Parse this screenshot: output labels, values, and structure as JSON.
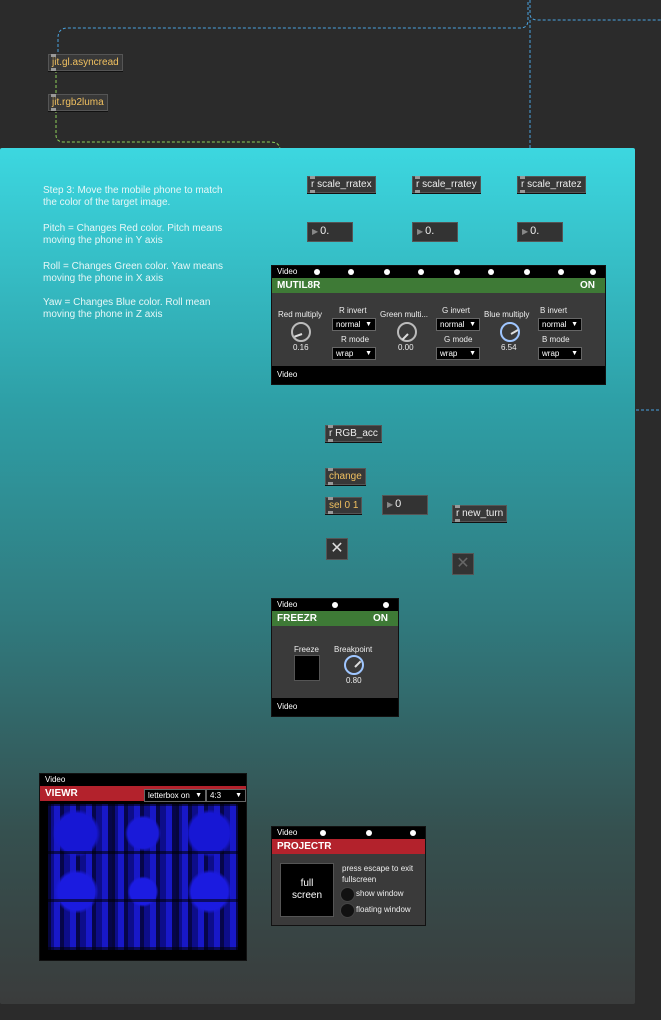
{
  "objects": {
    "asyncread": "jit.gl.asyncread",
    "rgb2luma": "jit.rgb2luma",
    "scale_x": "r scale_rratex",
    "scale_y": "r scale_rratey",
    "scale_z": "r scale_rratez",
    "num_x": "0.",
    "num_y": "0.",
    "num_z": "0.",
    "rgb_acc": "r RGB_acc",
    "change": "change",
    "sel": "sel 0 1",
    "num_sel": "0",
    "new_turn": "r new_turn"
  },
  "instructions": {
    "step": "Step 3: Move the mobile phone to match the color of the target image.",
    "pitch": "Pitch = Changes Red color. Pitch means moving the phone in Y axis",
    "roll": "Roll = Changes Green color. Yaw means moving the phone in X axis",
    "yaw": "Yaw =  Changes Blue color. Roll mean moving the phone in Z axis"
  },
  "mutil8r": {
    "top_label": "Video",
    "title": "MUTIL8R",
    "status": "ON",
    "red_label": "Red multiply",
    "red_value": "0.16",
    "green_label": "Green multi...",
    "green_value": "0.00",
    "blue_label": "Blue multiply",
    "blue_value": "6.54",
    "r_invert_label": "R invert",
    "r_invert": "normal",
    "r_mode_label": "R mode",
    "r_mode": "wrap",
    "g_invert_label": "G invert",
    "g_invert": "normal",
    "g_mode_label": "G mode",
    "g_mode": "wrap",
    "b_invert_label": "B invert",
    "b_invert": "normal",
    "b_mode_label": "B mode",
    "b_mode": "wrap",
    "foot_label": "Video"
  },
  "freezr": {
    "top_label": "Video",
    "title": "FREEZR",
    "status": "ON",
    "freeze_label": "Freeze",
    "breakpoint_label": "Breakpoint",
    "breakpoint_value": "0.80",
    "foot_label": "Video"
  },
  "viewr": {
    "top_label": "Video",
    "title": "VIEWR",
    "letterbox": "letterbox on",
    "aspect": "4:3"
  },
  "projectr": {
    "top_label": "Video",
    "title": "PROJECTR",
    "fullscreen_label": "full\nscreen",
    "escape_text": "press escape to exit fullscreen",
    "show_window": "show window",
    "floating_window": "floating window"
  },
  "colors": {
    "accent_green": "#3e7a36",
    "accent_red": "#b3222c",
    "patch_cord": "#8ccf5a",
    "dashed_cord": "#4aa3e0"
  }
}
